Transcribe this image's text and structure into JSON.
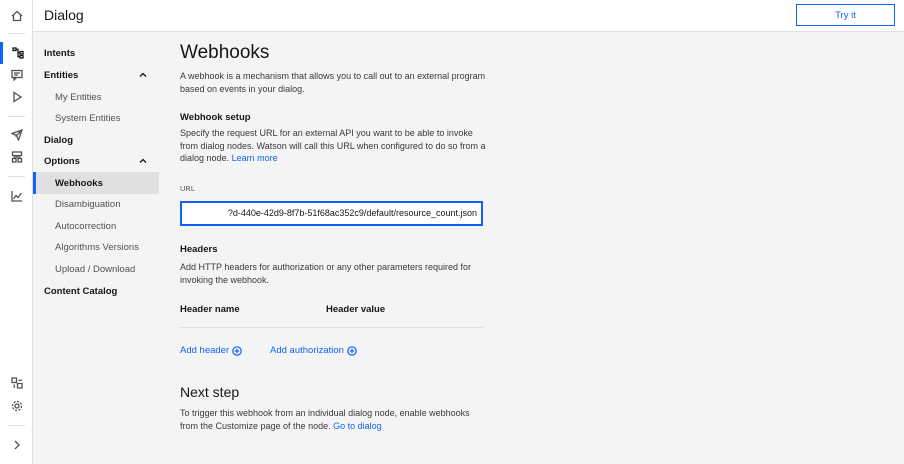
{
  "header": {
    "title": "Dialog",
    "try_label": "Try it"
  },
  "rail": {
    "icons": [
      "home-icon",
      "dialog-tree-icon",
      "chat-icon",
      "play-icon",
      "rocket-icon",
      "deploy-icon",
      "analytics-icon",
      "integrations-icon",
      "settings-icon",
      "expand-icon"
    ],
    "active": "dialog-tree-icon"
  },
  "subnav": {
    "items": [
      {
        "label": "Intents",
        "level": 1
      },
      {
        "label": "Entities",
        "level": 1,
        "expanded": true
      },
      {
        "label": "My Entities",
        "level": 2
      },
      {
        "label": "System Entities",
        "level": 2
      },
      {
        "label": "Dialog",
        "level": 1
      },
      {
        "label": "Options",
        "level": 1,
        "expanded": true
      },
      {
        "label": "Webhooks",
        "level": 2,
        "selected": true
      },
      {
        "label": "Disambiguation",
        "level": 2
      },
      {
        "label": "Autocorrection",
        "level": 2
      },
      {
        "label": "Algorithms Versions",
        "level": 2
      },
      {
        "label": "Upload / Download",
        "level": 2
      },
      {
        "label": "Content Catalog",
        "level": 1
      }
    ]
  },
  "main": {
    "title": "Webhooks",
    "intro": "A webhook is a mechanism that allows you to call out to an external program based on events in your dialog.",
    "setup": {
      "heading": "Webhook setup",
      "description": "Specify the request URL for an external API you want to be able to invoke from dialog nodes. Watson will call this URL when configured to do so from a dialog node.",
      "learn_more": "Learn more",
      "url_label": "URL",
      "url_value": "?d-440e-42d9-8f7b-51f68ac352c9/default/resource_count.json"
    },
    "headers": {
      "heading": "Headers",
      "description": "Add HTTP headers for authorization or any other parameters required for invoking the webhook.",
      "col_name": "Header name",
      "col_value": "Header value",
      "add_header": "Add header",
      "add_authorization": "Add authorization"
    },
    "next": {
      "heading": "Next step",
      "description": "To trigger this webhook from an individual dialog node, enable webhooks from the Customize page of the node.",
      "link": "Go to dialog"
    }
  },
  "colors": {
    "accent": "#0f62fe",
    "background": "#f4f4f4",
    "text": "#161616"
  }
}
